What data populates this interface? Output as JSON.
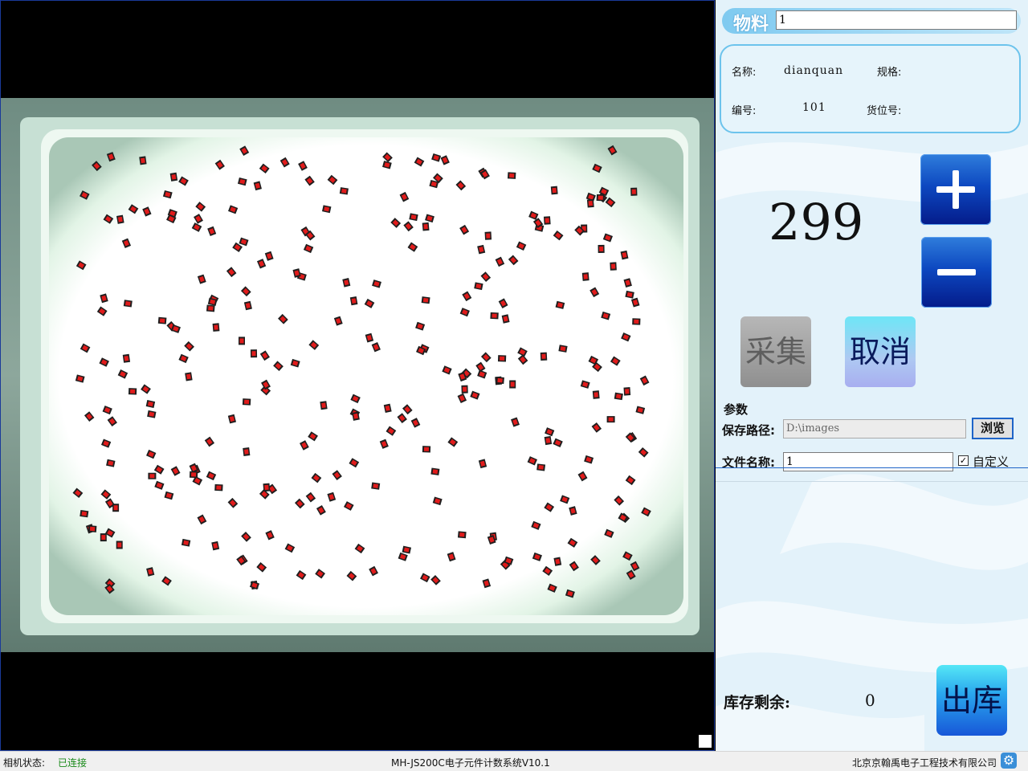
{
  "material": {
    "label": "物料",
    "value": "1"
  },
  "info": {
    "name_label": "名称:",
    "name_value": "dianquan",
    "spec_label": "规格:",
    "spec_value": "",
    "code_label": "编号:",
    "code_value": "101",
    "location_label": "货位号:",
    "location_value": ""
  },
  "count": "299",
  "buttons": {
    "plus_icon": "plus-icon",
    "minus_icon": "minus-icon",
    "collect": "采集",
    "cancel": "取消",
    "out": "出库",
    "browse": "浏览"
  },
  "params": {
    "title": "参数",
    "save_path_label": "保存路径:",
    "save_path_value": "D:\\images",
    "file_name_label": "文件名称:",
    "file_name_value": "1",
    "custom_checked": true,
    "custom_label": "自定义"
  },
  "stock": {
    "label": "库存剩余:",
    "value": "0"
  },
  "statusbar": {
    "camera_label": "相机状态:",
    "camera_status": "已连接",
    "app_title": "MH-JS200C电子元件计数系统V10.1",
    "company": "北京京翰禹电子工程技术有限公司",
    "settings_icon": "gear-icon"
  },
  "colors": {
    "accent_blue": "#0d48c0",
    "panel_bg": "#e3f2fa",
    "marker_red": "#e11b1b",
    "status_green": "#1a8a1a"
  }
}
